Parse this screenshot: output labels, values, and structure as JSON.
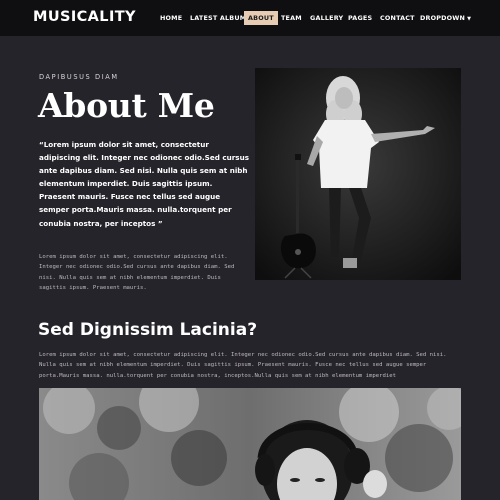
{
  "header": {
    "brand": "MUSICALITY",
    "nav": [
      {
        "label": "HOME"
      },
      {
        "label": "LATEST ALBUMS"
      },
      {
        "label": "ABOUT",
        "active": true
      },
      {
        "label": "TEAM"
      },
      {
        "label": "GALLERY"
      },
      {
        "label": "PAGES"
      },
      {
        "label": "CONTACT"
      },
      {
        "label": "DROPDOWN"
      }
    ]
  },
  "about": {
    "eyebrow": "DAPIBUSUS DIAM",
    "title": "About Me",
    "quote": "“Lorem ipsum dolor sit amet, consectetur adipiscing elit. Integer nec odionec odio.Sed cursus ante dapibus diam. Sed nisi. Nulla quis sem at nibh elementum imperdiet. Duis sagittis ipsum. Praesent mauris. Fusce nec tellus sed augue semper porta.Mauris massa. nulla.torquent per conubia nostra, per inceptos ”",
    "paragraph": "Lorem ipsum dolor sit amet, consectetur adipiscing elit. Integer nec odionec odio.Sed cursus ante dapibus diam. Sed nisi. Nulla quis sem at nibh elementum imperdiet. Duis sagittis ipsum. Praesent mauris."
  },
  "section2": {
    "heading": "Sed Dignissim Lacinia?",
    "paragraph": "Lorem ipsum dolor sit amet, consectetur adipiscing elit. Integer nec odionec odio.Sed cursus ante dapibus diam. Sed nisi. Nulla quis sem at nibh elementum imperdiet. Duis sagittis ipsum. Praesent mauris. Fusce nec tellus sed augue semper porta.Mauris massa. nulla.torquent per conubia nostra, inceptos.Nulla quis sem at nibh elementum imperdiet"
  },
  "colors": {
    "background": "#26242b",
    "header_bg": "#0f0f12",
    "nav_active_bg": "#e6ccb3",
    "text_primary": "#ffffff",
    "text_muted": "#bdbac0"
  },
  "icons": {
    "dropdown_caret": "chevron-down-icon"
  }
}
